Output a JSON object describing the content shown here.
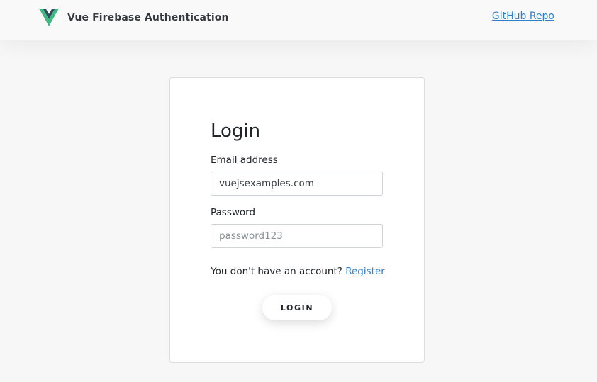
{
  "header": {
    "brand_title": "Vue Firebase Authentication",
    "github_link": "GitHub Repo",
    "logo_icon": "vue-logo-icon",
    "logo_colors": {
      "outer": "#41b883",
      "inner": "#35495e"
    }
  },
  "login_form": {
    "title": "Login",
    "email_label": "Email address",
    "email_value": "vuejsexamples.com",
    "password_label": "Password",
    "password_placeholder": "password123",
    "signup_prompt": "You don't have an account?",
    "register_link": "Register",
    "submit_label": "LOGIN"
  },
  "colors": {
    "link": "#2f80cf",
    "background": "#f6f6f6"
  }
}
